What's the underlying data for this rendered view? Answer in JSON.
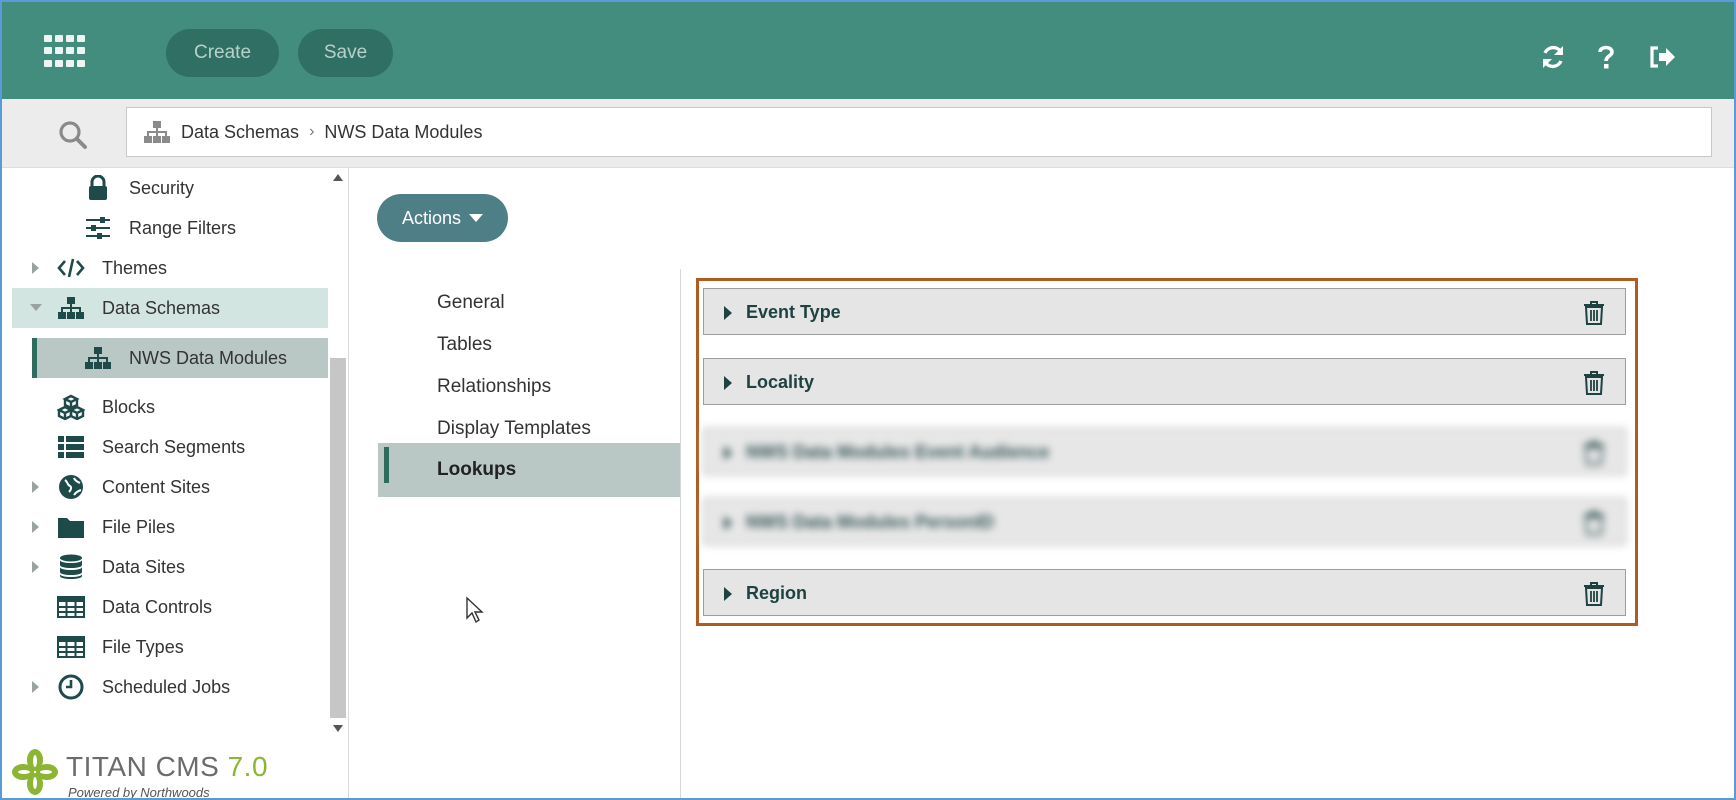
{
  "header": {
    "create_label": "Create",
    "save_label": "Save",
    "icons": [
      "apps-grid-icon",
      "refresh-icon",
      "help-icon",
      "logout-icon"
    ],
    "color": "#438d7e"
  },
  "breadcrumb": {
    "items": [
      "Data Schemas",
      "NWS Data Modules"
    ]
  },
  "sidebar": {
    "items": [
      {
        "label": "Security",
        "icon": "lock-icon"
      },
      {
        "label": "Range Filters",
        "icon": "sliders-icon"
      },
      {
        "label": "Themes",
        "icon": "code-icon"
      },
      {
        "label": "Data Schemas",
        "icon": "hierarchy-icon"
      },
      {
        "label": "NWS Data Modules",
        "icon": "hierarchy-icon"
      },
      {
        "label": "Blocks",
        "icon": "cubes-icon"
      },
      {
        "label": "Search Segments",
        "icon": "list-icon"
      },
      {
        "label": "Content Sites",
        "icon": "globe-icon"
      },
      {
        "label": "File Piles",
        "icon": "folder-icon"
      },
      {
        "label": "Data Sites",
        "icon": "database-icon"
      },
      {
        "label": "Data Controls",
        "icon": "table-icon"
      },
      {
        "label": "File Types",
        "icon": "table-icon"
      },
      {
        "label": "Scheduled Jobs",
        "icon": "clock-icon"
      }
    ]
  },
  "brand": {
    "name": "TITAN CMS",
    "version": "7.0",
    "tagline": "Powered by Northwoods"
  },
  "main": {
    "actions_label": "Actions",
    "nav": [
      "General",
      "Tables",
      "Relationships",
      "Display Templates",
      "Lookups"
    ],
    "active_nav": "Lookups",
    "lookups": [
      {
        "title": "Event Type",
        "blurred": false
      },
      {
        "title": "Locality",
        "blurred": false
      },
      {
        "title": "NWS Data Modules Event Audience",
        "blurred": true
      },
      {
        "title": "NWS Data Modules PersonID",
        "blurred": true
      },
      {
        "title": "Region",
        "blurred": false
      }
    ],
    "highlight_color": "#b05c20"
  }
}
